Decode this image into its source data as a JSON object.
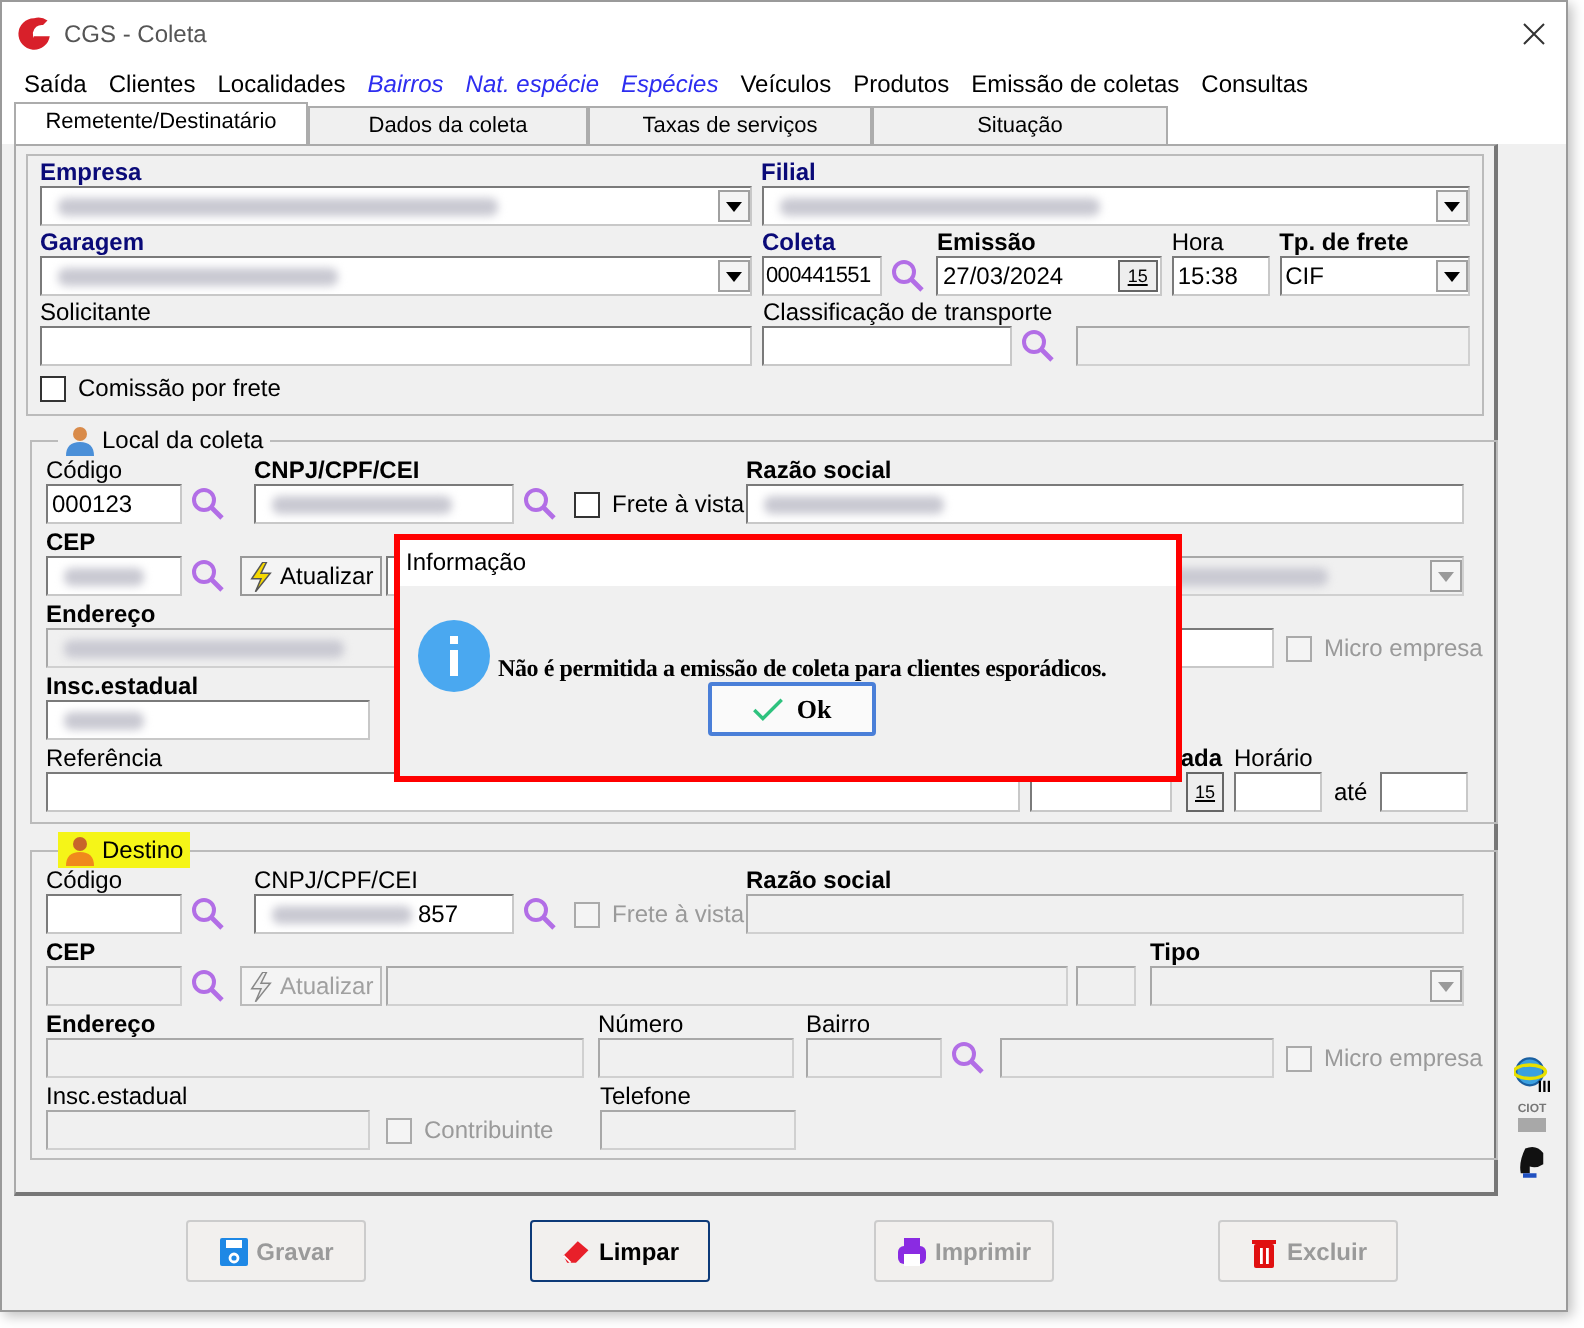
{
  "window": {
    "title": "CGS - Coleta"
  },
  "menu": [
    {
      "label": "Saída",
      "kind": "item"
    },
    {
      "label": "Clientes",
      "kind": "item"
    },
    {
      "label": "Localidades",
      "kind": "item"
    },
    {
      "label": "Bairros",
      "kind": "shortcut"
    },
    {
      "label": "Nat. espécie",
      "kind": "shortcut"
    },
    {
      "label": "Espécies",
      "kind": "shortcut"
    },
    {
      "label": "Veículos",
      "kind": "item"
    },
    {
      "label": "Produtos",
      "kind": "item"
    },
    {
      "label": "Emissão de coletas",
      "kind": "item"
    },
    {
      "label": "Consultas",
      "kind": "item"
    }
  ],
  "tabs": [
    {
      "label": "Remetente/Destinatário",
      "selected": true
    },
    {
      "label": "Dados da coleta",
      "selected": false
    },
    {
      "label": "Taxas de serviços",
      "selected": false
    },
    {
      "label": "Situação",
      "selected": false
    }
  ],
  "header": {
    "empresa": {
      "label": "Empresa",
      "kind": "key",
      "blurred": true
    },
    "filial": {
      "label": "Filial",
      "kind": "key",
      "blurred": true
    },
    "garagem": {
      "label": "Garagem",
      "kind": "key",
      "blurred": true
    },
    "coleta": {
      "label": "Coleta",
      "kind": "key",
      "value": "000441551"
    },
    "emissao": {
      "label": "Emissão",
      "kind": "bold",
      "value": "27/03/2024",
      "calendar_day": "15"
    },
    "hora": {
      "label": "Hora",
      "kind": "plain",
      "value": "15:38"
    },
    "tipo_frete": {
      "label": "Tp. de frete",
      "kind": "bold",
      "value": "CIF"
    },
    "solicitante": {
      "label": "Solicitante",
      "kind": "plain"
    },
    "classificacao": {
      "label": "Classificação de transporte",
      "kind": "plain"
    },
    "comissao": {
      "label": "Comissão por frete",
      "checked": false
    }
  },
  "local": {
    "title": "Local da coleta",
    "highlighted": false,
    "codigo": {
      "label": "Código",
      "kind": "plain",
      "value": "000123",
      "disabled": false
    },
    "cnpj": {
      "label": "CNPJ/CPF/CEI",
      "kind": "bold",
      "blurred": true,
      "disabled": false
    },
    "frete_vista": {
      "label": "Frete à vista",
      "checked": false,
      "disabled": false
    },
    "razao": {
      "label": "Razão social",
      "kind": "bold",
      "blurred": true,
      "disabled": false
    },
    "cep": {
      "label": "CEP",
      "kind": "bold",
      "blurred": true,
      "disabled": false
    },
    "atualizar": {
      "label": "Atualizar",
      "disabled": false
    },
    "tipo": {
      "blurred": true,
      "disabled": true
    },
    "endereco": {
      "label": "Endereço",
      "kind": "bold",
      "blurred": true,
      "disabled": true
    },
    "micro": {
      "label": "Micro empresa",
      "checked": false,
      "disabled": true
    },
    "insc": {
      "label": "Insc.estadual",
      "kind": "bold",
      "blurred": true,
      "disabled": false
    },
    "referencia": {
      "label": "Referência",
      "kind": "plain",
      "disabled": false
    },
    "data": {
      "label": "ada",
      "kind": "bold",
      "calendar_day": "15"
    },
    "horario": {
      "label": "Horário",
      "kind": "plain"
    },
    "ate": "até"
  },
  "destino": {
    "title": "Destino",
    "highlighted": true,
    "codigo": {
      "label": "Código",
      "kind": "plain",
      "disabled": false
    },
    "cnpj": {
      "label": "CNPJ/CPF/CEI",
      "kind": "plain",
      "blurred": true,
      "value": "857",
      "disabled": false
    },
    "frete_vista": {
      "label": "Frete à vista",
      "checked": false,
      "disabled": true
    },
    "razao": {
      "label": "Razão social",
      "kind": "bold",
      "disabled": true
    },
    "cep": {
      "label": "CEP",
      "kind": "bold",
      "disabled": true
    },
    "atualizar": {
      "label": "Atualizar",
      "disabled": true
    },
    "tipo": {
      "label": "Tipo",
      "kind": "bold",
      "disabled": true
    },
    "endereco": {
      "label": "Endereço",
      "kind": "bold",
      "disabled": true
    },
    "numero": {
      "label": "Número",
      "kind": "plain",
      "disabled": true
    },
    "bairro": {
      "label": "Bairro",
      "kind": "plain",
      "disabled": true
    },
    "micro": {
      "label": "Micro empresa",
      "checked": false,
      "disabled": true
    },
    "insc": {
      "label": "Insc.estadual",
      "kind": "plain",
      "disabled": true
    },
    "contribuinte": {
      "label": "Contribuinte",
      "checked": false,
      "disabled": true
    },
    "telefone": {
      "label": "Telefone",
      "kind": "plain",
      "disabled": true
    }
  },
  "side_tools": {
    "ciot": "CIOT"
  },
  "buttons": [
    {
      "label": "Gravar",
      "kind": "save",
      "disabled": true,
      "focused": false
    },
    {
      "label": "Limpar",
      "kind": "clear",
      "disabled": false,
      "focused": true
    },
    {
      "label": "Imprimir",
      "kind": "print",
      "disabled": true,
      "focused": false
    },
    {
      "label": "Excluir",
      "kind": "delete",
      "disabled": true,
      "focused": false
    }
  ],
  "dialog": {
    "title": "Informação",
    "message": "Não é permitida a emissão de coleta para clientes esporádicos.",
    "button": "Ok"
  }
}
